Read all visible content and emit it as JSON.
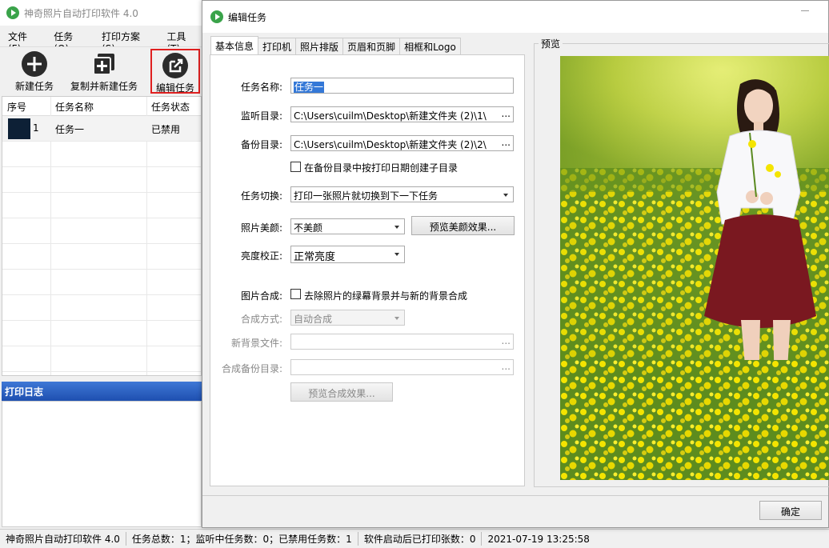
{
  "main": {
    "title": "神奇照片自动打印软件 4.0",
    "menu": [
      "文件(F)",
      "任务(O)",
      "打印方案(S)",
      "工具(T)"
    ],
    "toolbar": {
      "new_task": "新建任务",
      "copy_new_task": "复制并新建任务",
      "edit_task": "编辑任务"
    },
    "grid": {
      "headers": [
        "序号",
        "任务名称",
        "任务状态"
      ],
      "rows": [
        {
          "index": "1",
          "name": "任务一",
          "status": "已禁用"
        }
      ]
    },
    "log_title": "打印日志"
  },
  "statusbar": {
    "app": "神奇照片自动打印软件 4.0",
    "counts": "任务总数：1；监听中任务数：0；已禁用任务数：1",
    "printed": "软件启动后已打印张数：0",
    "time": "2021-07-19 13:25:58"
  },
  "dialog": {
    "title": "编辑任务",
    "tabs": [
      "基本信息",
      "打印机",
      "照片排版",
      "页眉和页脚",
      "相框和Logo"
    ],
    "labels": {
      "task_name": "任务名称:",
      "watch_dir": "监听目录:",
      "backup_dir": "备份目录:",
      "task_switch": "任务切换:",
      "beauty": "照片美颜:",
      "brightness": "亮度校正:",
      "compose": "图片合成:",
      "compose_mode": "合成方式:",
      "new_bg": "新背景文件:",
      "compose_backup": "合成备份目录:"
    },
    "values": {
      "task_name": "任务一",
      "watch_dir": "C:\\Users\\cuilm\\Desktop\\新建文件夹 (2)\\1\\",
      "backup_dir": "C:\\Users\\cuilm\\Desktop\\新建文件夹 (2)\\2\\",
      "task_switch": "打印一张照片就切换到下一下任务",
      "beauty": "不美颜",
      "brightness": "正常亮度",
      "compose_mode": "自动合成",
      "new_bg": "",
      "compose_backup": ""
    },
    "ellipsis": "...",
    "subdir_checkbox": "在备份目录中按打印日期创建子目录",
    "compose_checkbox": "去除照片的绿幕背景并与新的背景合成",
    "preview_beauty_btn": "预览美颜效果...",
    "preview_compose_btn": "预览合成效果...",
    "preview_legend": "预览",
    "ok": "确定"
  }
}
